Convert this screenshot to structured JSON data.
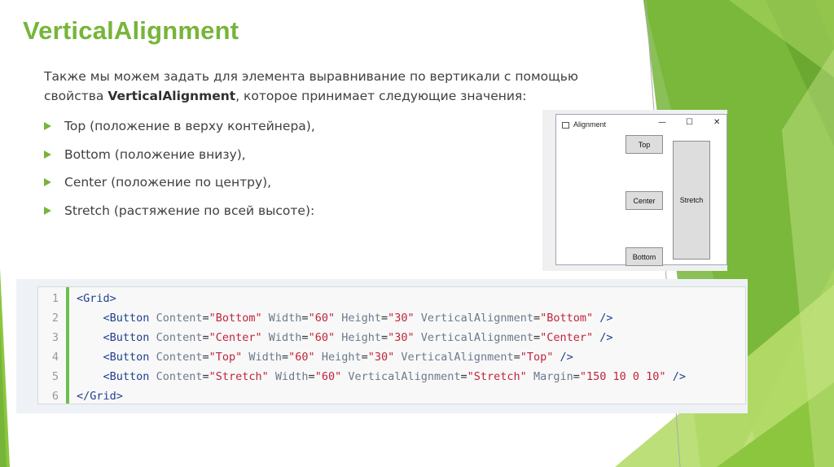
{
  "slide": {
    "title": "VerticalAlignment",
    "intro_plain_1": "Также мы можем задать для элемента выравнивание по вертикали с помощью свойства ",
    "intro_bold": "VerticalAlignment",
    "intro_plain_2": ", которое принимает следующие значения:",
    "bullets": [
      "Top (положение в верху контейнера),",
      "Bottom (положение внизу),",
      "Center (положение по центру),",
      "Stretch (растяжение по всей высоте):"
    ]
  },
  "window": {
    "title": "Alignment",
    "minimize": "—",
    "maximize": "☐",
    "close": "✕",
    "buttons": {
      "top": "Top",
      "center": "Center",
      "bottom": "Bottom",
      "stretch": "Stretch"
    }
  },
  "code": {
    "line_numbers": [
      "1",
      "2",
      "3",
      "4",
      "5",
      "6"
    ],
    "lines": [
      [
        [
          "t",
          "<Grid"
        ],
        [
          "t",
          ">"
        ]
      ],
      [
        [
          "p",
          "    "
        ],
        [
          "t",
          "<Button"
        ],
        [
          "p",
          " "
        ],
        [
          "a",
          "Content"
        ],
        [
          "p",
          "="
        ],
        [
          "v",
          "\"Bottom\""
        ],
        [
          "p",
          " "
        ],
        [
          "a",
          "Width"
        ],
        [
          "p",
          "="
        ],
        [
          "v",
          "\"60\""
        ],
        [
          "p",
          " "
        ],
        [
          "a",
          "Height"
        ],
        [
          "p",
          "="
        ],
        [
          "v",
          "\"30\""
        ],
        [
          "p",
          " "
        ],
        [
          "a",
          "VerticalAlignment"
        ],
        [
          "p",
          "="
        ],
        [
          "v",
          "\"Bottom\""
        ],
        [
          "p",
          " "
        ],
        [
          "t",
          "/>"
        ]
      ],
      [
        [
          "p",
          "    "
        ],
        [
          "t",
          "<Button"
        ],
        [
          "p",
          " "
        ],
        [
          "a",
          "Content"
        ],
        [
          "p",
          "="
        ],
        [
          "v",
          "\"Center\""
        ],
        [
          "p",
          " "
        ],
        [
          "a",
          "Width"
        ],
        [
          "p",
          "="
        ],
        [
          "v",
          "\"60\""
        ],
        [
          "p",
          " "
        ],
        [
          "a",
          "Height"
        ],
        [
          "p",
          "="
        ],
        [
          "v",
          "\"30\""
        ],
        [
          "p",
          " "
        ],
        [
          "a",
          "VerticalAlignment"
        ],
        [
          "p",
          "="
        ],
        [
          "v",
          "\"Center\""
        ],
        [
          "p",
          " "
        ],
        [
          "t",
          "/>"
        ]
      ],
      [
        [
          "p",
          "    "
        ],
        [
          "t",
          "<Button"
        ],
        [
          "p",
          " "
        ],
        [
          "a",
          "Content"
        ],
        [
          "p",
          "="
        ],
        [
          "v",
          "\"Top\""
        ],
        [
          "p",
          " "
        ],
        [
          "a",
          "Width"
        ],
        [
          "p",
          "="
        ],
        [
          "v",
          "\"60\""
        ],
        [
          "p",
          " "
        ],
        [
          "a",
          "Height"
        ],
        [
          "p",
          "="
        ],
        [
          "v",
          "\"30\""
        ],
        [
          "p",
          " "
        ],
        [
          "a",
          "VerticalAlignment"
        ],
        [
          "p",
          "="
        ],
        [
          "v",
          "\"Top\""
        ],
        [
          "p",
          " "
        ],
        [
          "t",
          "/>"
        ]
      ],
      [
        [
          "p",
          "    "
        ],
        [
          "t",
          "<Button"
        ],
        [
          "p",
          " "
        ],
        [
          "a",
          "Content"
        ],
        [
          "p",
          "="
        ],
        [
          "v",
          "\"Stretch\""
        ],
        [
          "p",
          " "
        ],
        [
          "a",
          "Width"
        ],
        [
          "p",
          "="
        ],
        [
          "v",
          "\"60\""
        ],
        [
          "p",
          " "
        ],
        [
          "a",
          "VerticalAlignment"
        ],
        [
          "p",
          "="
        ],
        [
          "v",
          "\"Stretch\""
        ],
        [
          "p",
          " "
        ],
        [
          "a",
          "Margin"
        ],
        [
          "p",
          "="
        ],
        [
          "v",
          "\"150 10 0 10\""
        ],
        [
          "p",
          " "
        ],
        [
          "t",
          "/>"
        ]
      ],
      [
        [
          "t",
          "</Grid"
        ],
        [
          "t",
          ">"
        ]
      ]
    ]
  },
  "colors": {
    "accent": "#76b539",
    "code_tag": "#1f3f8f",
    "code_attr": "#6a7a8c",
    "code_value": "#c0243b",
    "gutter_bar": "#6cc04a"
  }
}
